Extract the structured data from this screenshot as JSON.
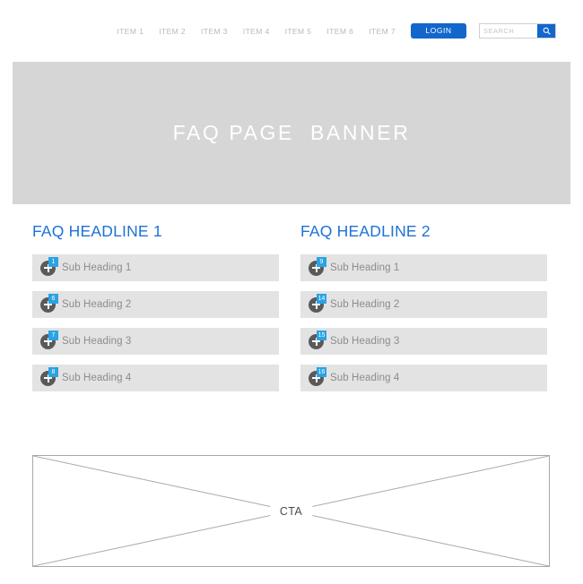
{
  "header": {
    "nav_items": [
      {
        "label": "ITEM 1"
      },
      {
        "label": "ITEM 2"
      },
      {
        "label": "ITEM 3"
      },
      {
        "label": "ITEM 4"
      },
      {
        "label": "ITEM 5"
      },
      {
        "label": "ITEM 6"
      },
      {
        "label": "ITEM 7"
      }
    ],
    "login_label": "LOGIN",
    "search": {
      "placeholder": "SEARCH",
      "value": "",
      "icon": "search-icon"
    }
  },
  "banner": {
    "title": "FAQ PAGE  BANNER",
    "background_color": "#d6d6d6",
    "text_color": "#ffffff"
  },
  "faq": {
    "columns": [
      {
        "heading": "FAQ HEADLINE 1",
        "rows": [
          {
            "badge": "1",
            "label": "Sub Heading 1",
            "icon": "plus-circle-icon"
          },
          {
            "badge": "6",
            "label": "Sub Heading 2",
            "icon": "plus-circle-icon"
          },
          {
            "badge": "7",
            "label": "Sub Heading 3",
            "icon": "plus-circle-icon"
          },
          {
            "badge": "8",
            "label": "Sub Heading 4",
            "icon": "plus-circle-icon"
          }
        ]
      },
      {
        "heading": "FAQ HEADLINE 2",
        "rows": [
          {
            "badge": "9",
            "label": "Sub Heading 1",
            "icon": "plus-circle-icon"
          },
          {
            "badge": "14",
            "label": "Sub Heading 2",
            "icon": "plus-circle-icon"
          },
          {
            "badge": "15",
            "label": "Sub Heading 3",
            "icon": "plus-circle-icon"
          },
          {
            "badge": "16",
            "label": "Sub Heading 4",
            "icon": "plus-circle-icon"
          }
        ]
      }
    ]
  },
  "cta": {
    "label": "CTA"
  },
  "colors": {
    "accent_blue": "#1266cc",
    "heading_blue": "#1f72d6",
    "badge_blue": "#29a3e3",
    "row_gray": "#e3e3e3",
    "banner_gray": "#d6d6d6",
    "nav_gray": "#b9b9b9"
  }
}
